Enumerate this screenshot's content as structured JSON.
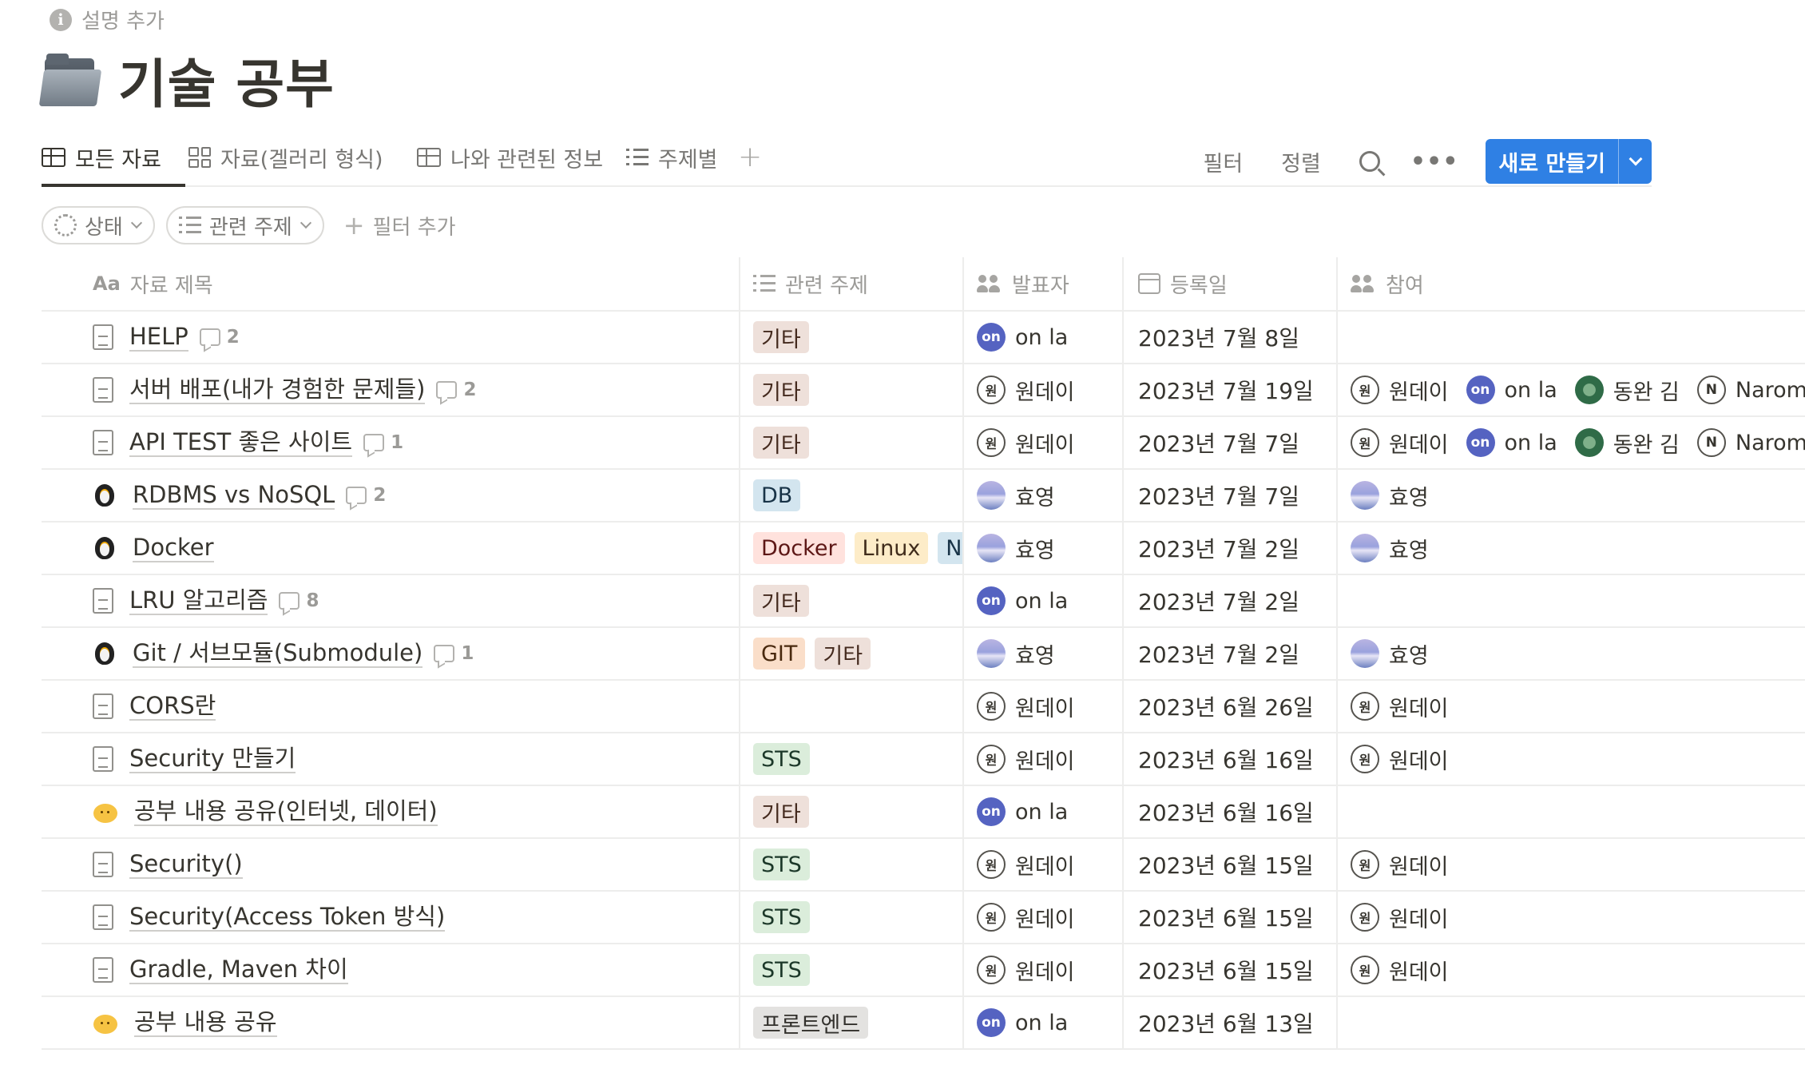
{
  "page": {
    "description_label": "설명 추가",
    "title": "기술 공부"
  },
  "tabs": [
    {
      "label": "모든 자료",
      "icon": "table-icon",
      "active": true
    },
    {
      "label": "자료(겔러리 형식)",
      "icon": "gallery-icon",
      "active": false
    },
    {
      "label": "나와 관련된 정보",
      "icon": "table-icon",
      "active": false
    },
    {
      "label": "주제별",
      "icon": "list-icon",
      "active": false
    }
  ],
  "toolbar": {
    "filter_label": "필터",
    "sort_label": "정렬",
    "new_label": "새로 만들기",
    "accent_color": "#2f80e4"
  },
  "filters": {
    "status_label": "상태",
    "topic_label": "관련 주제",
    "add_filter_label": "필터 추가"
  },
  "columns": {
    "title": "자료 제목",
    "title_icon_text": "Aa",
    "topic": "관련 주제",
    "presenter": "발표자",
    "date": "등록일",
    "participants": "참여"
  },
  "rows": [
    {
      "icon": "doc",
      "title": "HELP",
      "comments": "2",
      "tags": [
        {
          "t": "기타",
          "c": "t-etc"
        }
      ],
      "presenter": {
        "name": "on la",
        "av": "av-on",
        "txt": "on"
      },
      "date": "2023년 7월 8일",
      "participants": []
    },
    {
      "icon": "doc",
      "title": "서버 배포(내가 경험한 문제들)",
      "comments": "2",
      "tags": [
        {
          "t": "기타",
          "c": "t-etc"
        }
      ],
      "presenter": {
        "name": "원데이",
        "av": "av-won",
        "txt": "원"
      },
      "date": "2023년 7월 19일",
      "participants": [
        {
          "name": "원데이",
          "av": "av-won",
          "txt": "원"
        },
        {
          "name": "on la",
          "av": "av-on",
          "txt": "on"
        },
        {
          "name": "동완 김",
          "av": "av-green",
          "txt": ""
        },
        {
          "name": "Narom",
          "av": "av-n",
          "txt": "N"
        }
      ]
    },
    {
      "icon": "doc",
      "title": "API TEST 좋은 사이트",
      "comments": "1",
      "tags": [
        {
          "t": "기타",
          "c": "t-etc"
        }
      ],
      "presenter": {
        "name": "원데이",
        "av": "av-won",
        "txt": "원"
      },
      "date": "2023년 7월 7일",
      "participants": [
        {
          "name": "원데이",
          "av": "av-won",
          "txt": "원"
        },
        {
          "name": "on la",
          "av": "av-on",
          "txt": "on"
        },
        {
          "name": "동완 김",
          "av": "av-green",
          "txt": ""
        },
        {
          "name": "Narom",
          "av": "av-n",
          "txt": "N"
        }
      ]
    },
    {
      "icon": "penguin",
      "title": "RDBMS vs NoSQL",
      "comments": "2",
      "tags": [
        {
          "t": "DB",
          "c": "t-db"
        }
      ],
      "presenter": {
        "name": "효영",
        "av": "av-sky",
        "txt": ""
      },
      "date": "2023년 7월 7일",
      "participants": [
        {
          "name": "효영",
          "av": "av-sky",
          "txt": ""
        }
      ]
    },
    {
      "icon": "penguin",
      "title": "Docker",
      "comments": "",
      "tags": [
        {
          "t": "Docker",
          "c": "t-docker"
        },
        {
          "t": "Linux",
          "c": "t-linux"
        },
        {
          "t": "N",
          "c": "t-db"
        }
      ],
      "presenter": {
        "name": "효영",
        "av": "av-sky",
        "txt": ""
      },
      "date": "2023년 7월 2일",
      "participants": [
        {
          "name": "효영",
          "av": "av-sky",
          "txt": ""
        }
      ]
    },
    {
      "icon": "doc",
      "title": "LRU 알고리즘",
      "comments": "8",
      "tags": [
        {
          "t": "기타",
          "c": "t-etc"
        }
      ],
      "presenter": {
        "name": "on la",
        "av": "av-on",
        "txt": "on"
      },
      "date": "2023년 7월 2일",
      "participants": []
    },
    {
      "icon": "penguin",
      "title": "Git / 서브모듈(Submodule)",
      "comments": "1",
      "tags": [
        {
          "t": "GIT",
          "c": "t-git"
        },
        {
          "t": "기타",
          "c": "t-etc"
        }
      ],
      "presenter": {
        "name": "효영",
        "av": "av-sky",
        "txt": ""
      },
      "date": "2023년 7월 2일",
      "participants": [
        {
          "name": "효영",
          "av": "av-sky",
          "txt": ""
        }
      ]
    },
    {
      "icon": "doc",
      "title": "CORS란",
      "comments": "",
      "tags": [],
      "presenter": {
        "name": "원데이",
        "av": "av-won",
        "txt": "원"
      },
      "date": "2023년 6월 26일",
      "participants": [
        {
          "name": "원데이",
          "av": "av-won",
          "txt": "원"
        }
      ]
    },
    {
      "icon": "doc",
      "title": "Security 만들기",
      "comments": "",
      "tags": [
        {
          "t": "STS",
          "c": "t-sts"
        }
      ],
      "presenter": {
        "name": "원데이",
        "av": "av-won",
        "txt": "원"
      },
      "date": "2023년 6월 16일",
      "participants": [
        {
          "name": "원데이",
          "av": "av-won",
          "txt": "원"
        }
      ]
    },
    {
      "icon": "cat",
      "title": "공부 내용 공유(인터넷, 데이터)",
      "comments": "",
      "tags": [
        {
          "t": "기타",
          "c": "t-etc"
        }
      ],
      "presenter": {
        "name": "on la",
        "av": "av-on",
        "txt": "on"
      },
      "date": "2023년 6월 16일",
      "participants": []
    },
    {
      "icon": "doc",
      "title": "Security()",
      "comments": "",
      "tags": [
        {
          "t": "STS",
          "c": "t-sts"
        }
      ],
      "presenter": {
        "name": "원데이",
        "av": "av-won",
        "txt": "원"
      },
      "date": "2023년 6월 15일",
      "participants": [
        {
          "name": "원데이",
          "av": "av-won",
          "txt": "원"
        }
      ]
    },
    {
      "icon": "doc",
      "title": "Security(Access Token 방식)",
      "comments": "",
      "tags": [
        {
          "t": "STS",
          "c": "t-sts"
        }
      ],
      "presenter": {
        "name": "원데이",
        "av": "av-won",
        "txt": "원"
      },
      "date": "2023년 6월 15일",
      "participants": [
        {
          "name": "원데이",
          "av": "av-won",
          "txt": "원"
        }
      ]
    },
    {
      "icon": "doc",
      "title": "Gradle, Maven 차이",
      "comments": "",
      "tags": [
        {
          "t": "STS",
          "c": "t-sts"
        }
      ],
      "presenter": {
        "name": "원데이",
        "av": "av-won",
        "txt": "원"
      },
      "date": "2023년 6월 15일",
      "participants": [
        {
          "name": "원데이",
          "av": "av-won",
          "txt": "원"
        }
      ]
    },
    {
      "icon": "cat",
      "title": "공부 내용 공유",
      "comments": "",
      "tags": [
        {
          "t": "프론트엔드",
          "c": "t-fe"
        }
      ],
      "presenter": {
        "name": "on la",
        "av": "av-on",
        "txt": "on"
      },
      "date": "2023년 6월 13일",
      "participants": []
    }
  ]
}
